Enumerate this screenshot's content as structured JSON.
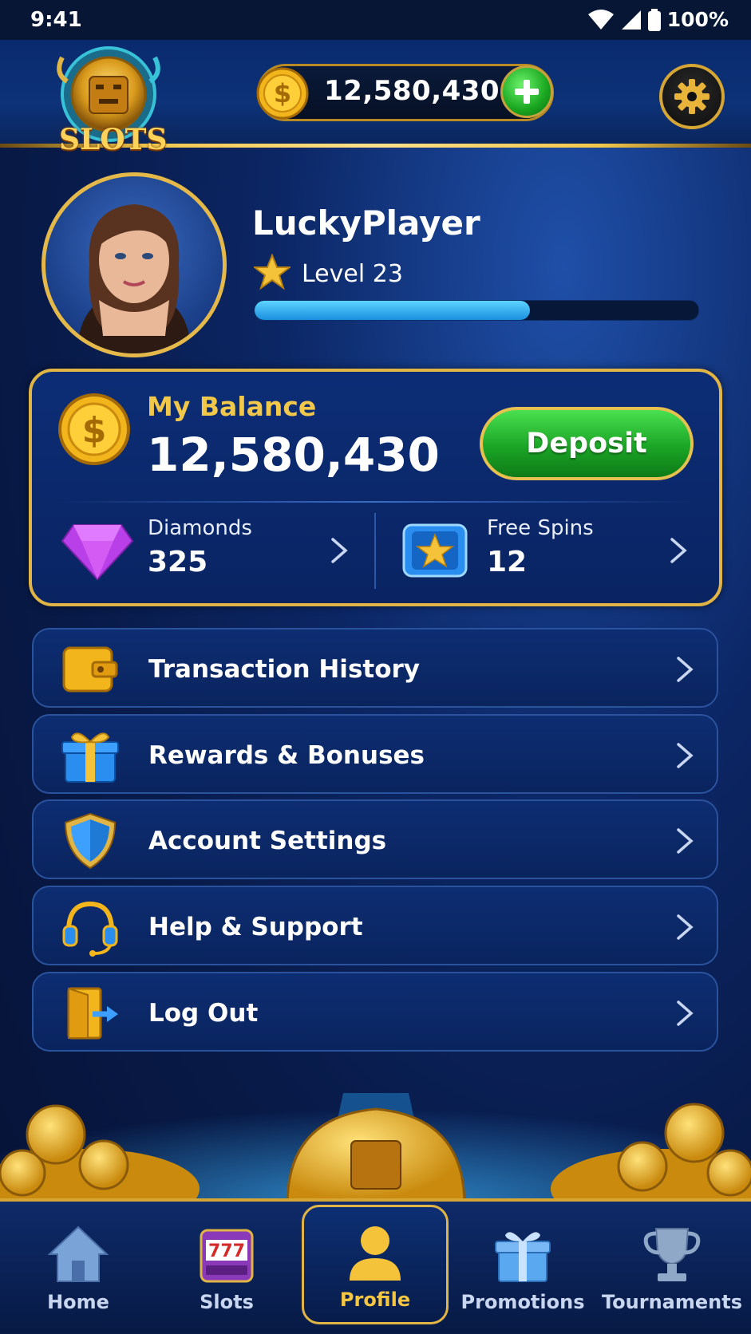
{
  "status_bar": {
    "time": "9:41",
    "battery": "100%"
  },
  "header": {
    "logo_text": "SLOTS",
    "coin_balance": "12,580,430",
    "icons": [
      "coin-icon",
      "plus-icon",
      "gear-icon"
    ]
  },
  "profile": {
    "username": "LuckyPlayer",
    "level": "Level 23",
    "xp_progress": 0.62
  },
  "balance_card": {
    "label": "My Balance",
    "value": "12,580,430",
    "deposit_label": "Deposit",
    "stats": [
      {
        "label": "Diamonds",
        "value": "325",
        "icon": "diamond-icon"
      },
      {
        "label": "Free Spins",
        "value": "12",
        "icon": "ticket-star-icon"
      }
    ]
  },
  "menu": [
    {
      "label": "Transaction History",
      "icon": "wallet-icon"
    },
    {
      "label": "Rewards & Bonuses",
      "icon": "gift-icon"
    },
    {
      "label": "Account Settings",
      "icon": "shield-icon"
    },
    {
      "label": "Help & Support",
      "icon": "headset-icon"
    },
    {
      "label": "Log Out",
      "icon": "logout-icon"
    }
  ],
  "nav": [
    {
      "label": "Home",
      "icon": "home-icon",
      "active": false
    },
    {
      "label": "Slots",
      "icon": "slot-machine-icon",
      "active": false
    },
    {
      "label": "Profile",
      "icon": "user-icon",
      "active": true
    },
    {
      "label": "Promotions",
      "icon": "gift-icon",
      "active": false
    },
    {
      "label": "Tournaments",
      "icon": "trophy-icon",
      "active": false
    }
  ],
  "colors": {
    "background": "#0a2058",
    "gold": "#e0b445",
    "accent_yellow": "#f2c84b",
    "deposit_green": "#1ba526",
    "xp_blue": "#2aa6f0"
  }
}
